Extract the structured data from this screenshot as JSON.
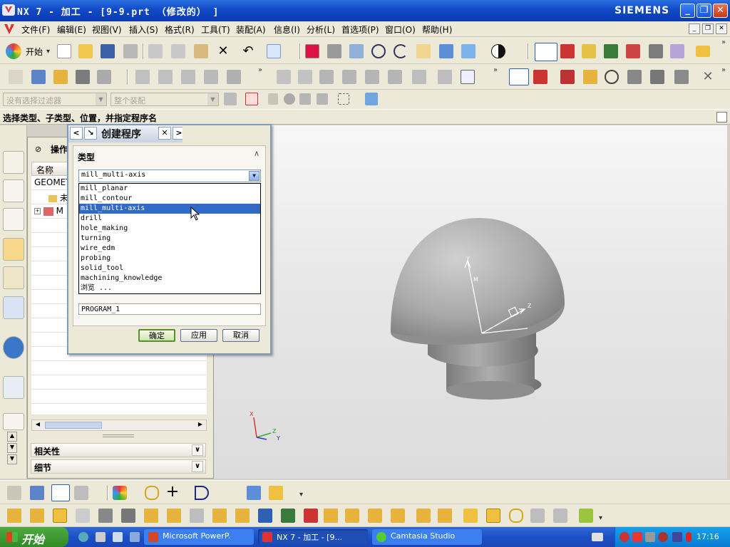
{
  "window": {
    "title": "NX 7 - 加工 - [9-9.prt （修改的） ]",
    "brand": "SIEMENS",
    "minimize": "_",
    "restore": "❐",
    "close": "✕"
  },
  "menu": {
    "items": [
      "文件(F)",
      "编辑(E)",
      "视图(V)",
      "插入(S)",
      "格式(R)",
      "工具(T)",
      "装配(A)",
      "信息(I)",
      "分析(L)",
      "首选项(P)",
      "窗口(O)",
      "帮助(H)"
    ]
  },
  "toolbar": {
    "start_label": "开始"
  },
  "filterbar": {
    "selection_filter": "没有选择过滤器",
    "scope": "整个装配"
  },
  "cue_line": "选择类型、子类型、位置，并指定程序名",
  "navigator": {
    "header": "操作",
    "column_name": "名称",
    "rows": [
      "GEOMET",
      "未",
      "M"
    ]
  },
  "panel_sections": {
    "dependencies": "相关性",
    "details": "细节"
  },
  "dialog": {
    "title": "创建程序",
    "type_group_label": "类型",
    "type_value": "mill_multi-axis",
    "options": [
      "mill_planar",
      "mill_contour",
      "mill_multi-axis",
      "drill",
      "hole_making",
      "turning",
      "wire_edm",
      "probing",
      "solid_tool",
      "machining_knowledge",
      "浏览 ..."
    ],
    "selected_index": 2,
    "name_value": "PROGRAM_1",
    "buttons": {
      "ok": "确定",
      "apply": "应用",
      "cancel": "取消"
    }
  },
  "viewport": {
    "axis_labels": {
      "x": "X",
      "y": "Y",
      "z": "Z",
      "m": "M"
    }
  },
  "taskbar": {
    "start": "开始",
    "tasks": [
      "Microsoft PowerP.",
      "NX 7 - 加工 - [9...",
      "Camtasia Studio"
    ],
    "clock": "17:16"
  }
}
